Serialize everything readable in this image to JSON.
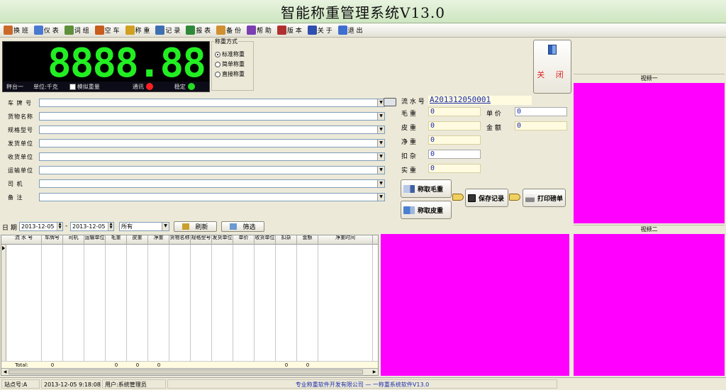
{
  "app": {
    "title": "智能称重管理系统V13.0"
  },
  "toolbar": [
    {
      "name": "shift",
      "label": "换 班",
      "color": "#c96a2a"
    },
    {
      "name": "meter",
      "label": "仪 表",
      "color": "#4a7ad0"
    },
    {
      "name": "word-group",
      "label": "词 组",
      "color": "#5e8f3a"
    },
    {
      "name": "empty-truck",
      "label": "空 车",
      "color": "#c85c1a"
    },
    {
      "name": "weigh",
      "label": "称 重",
      "color": "#d0a020"
    },
    {
      "name": "record",
      "label": "记 录",
      "color": "#3f6fb0"
    },
    {
      "name": "report",
      "label": "报 表",
      "color": "#2e8a3a"
    },
    {
      "name": "backup",
      "label": "备 份",
      "color": "#d09030"
    },
    {
      "name": "help",
      "label": "帮 助",
      "color": "#7a3fb0"
    },
    {
      "name": "version",
      "label": "版 本",
      "color": "#b03030"
    },
    {
      "name": "about",
      "label": "关 于",
      "color": "#2f4fb0"
    },
    {
      "name": "exit",
      "label": "退 出",
      "color": "#3f6fd0"
    }
  ],
  "scale": {
    "weight": "8888.88",
    "platform": "秤台一",
    "unit": "单位:千克",
    "simulate_label": "模拟重量",
    "comm_label": "通讯",
    "stable_label": "稳定",
    "comm_color": "#ff2020",
    "stable_color": "#22dd22"
  },
  "weigh_mode": {
    "legend": "称重方式",
    "options": [
      "标准称重",
      "简单称重",
      "直接称重"
    ],
    "selected": 0
  },
  "close_label": "关 闭",
  "form": {
    "fields": [
      {
        "name": "plate",
        "label": "车 牌 号",
        "value": ""
      },
      {
        "name": "goods",
        "label": "货物名称",
        "value": ""
      },
      {
        "name": "spec",
        "label": "规格型号",
        "value": ""
      },
      {
        "name": "sender",
        "label": "发货单位",
        "value": ""
      },
      {
        "name": "receiver",
        "label": "收货单位",
        "value": ""
      },
      {
        "name": "carrier",
        "label": "运输单位",
        "value": ""
      },
      {
        "name": "driver",
        "label": "司    机",
        "value": ""
      },
      {
        "name": "remark",
        "label": "备    注",
        "value": ""
      }
    ]
  },
  "detail": {
    "serial_label": "流 水 号",
    "serial_value": "A201312050001",
    "gross_label": "毛    重",
    "gross_value": "0",
    "tare_label": "皮    重",
    "tare_value": "0",
    "net_label": "净    重",
    "net_value": "0",
    "deduct_label": "扣    杂",
    "deduct_value": "0",
    "actual_label": "实    重",
    "actual_value": "0",
    "price_label": "单    价",
    "price_value": "0",
    "amount_label": "金    额",
    "amount_value": "0"
  },
  "actions": {
    "gross": "称取毛重",
    "tare": "称取皮重",
    "save": "保存记录",
    "print": "打印磅单"
  },
  "filter": {
    "date_label": "日 期",
    "date_from": "2013-12-05",
    "date_sep": "-",
    "date_to": "2013-12-05",
    "status": "所有",
    "refresh": "刷新",
    "filter": "筛选"
  },
  "grid": {
    "columns": [
      "流 水 号",
      "车牌号",
      "司机",
      "运输单位",
      "毛重",
      "皮重",
      "净重",
      "货物名称",
      "规格型号",
      "发货单位",
      "单价",
      "收货单位",
      "扣杂",
      "金额",
      "净重时间"
    ],
    "footer": {
      "label": "Total:",
      "values": [
        "0",
        "",
        "",
        "0",
        "0",
        "0",
        "",
        "",
        "",
        "",
        "",
        "0",
        "0"
      ]
    }
  },
  "videos": {
    "video1": "视频一",
    "video2": "视频二"
  },
  "status": {
    "station": "站点号:A",
    "datetime": "2013-12-05 9:18:08",
    "user": "用户:系统管理员",
    "company": "专业称重软件开发有限公司 — 一称重系统软件V13.0"
  }
}
